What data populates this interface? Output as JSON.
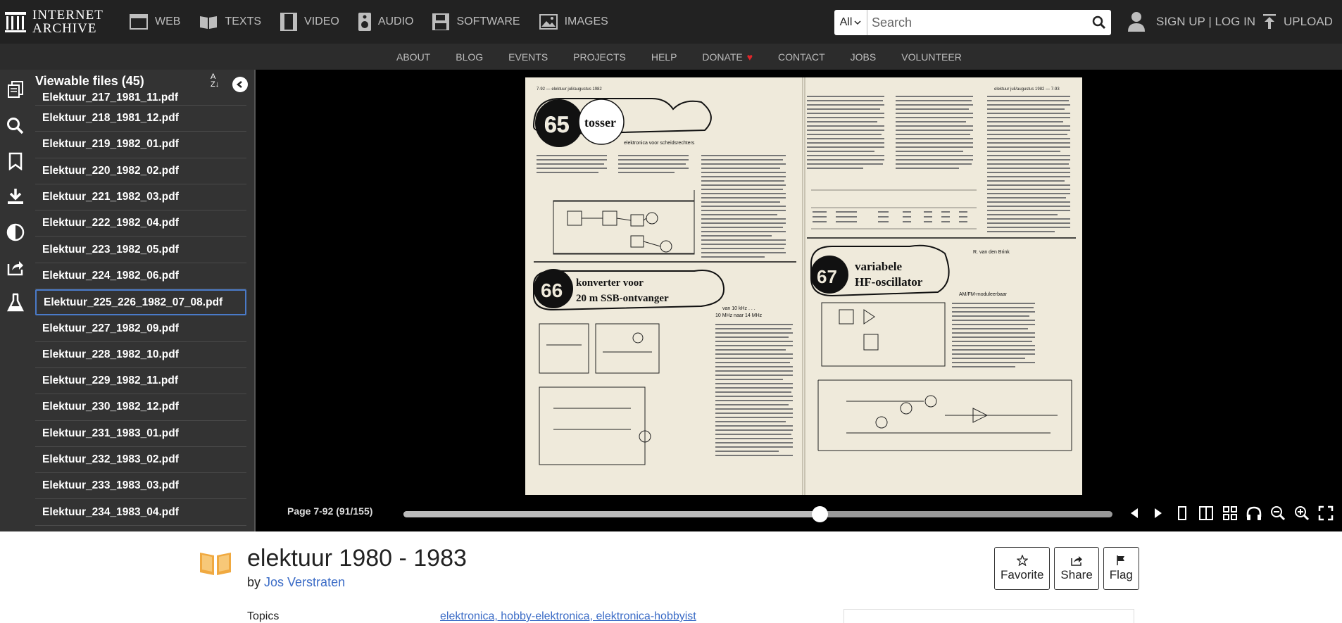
{
  "header": {
    "logo_line1": "INTERNET",
    "logo_line2": "ARCHIVE",
    "media_nav": [
      {
        "label": "WEB",
        "icon": "web-icon"
      },
      {
        "label": "TEXTS",
        "icon": "book-icon"
      },
      {
        "label": "VIDEO",
        "icon": "film-icon"
      },
      {
        "label": "AUDIO",
        "icon": "speaker-icon"
      },
      {
        "label": "SOFTWARE",
        "icon": "floppy-icon"
      },
      {
        "label": "IMAGES",
        "icon": "image-icon"
      }
    ],
    "search": {
      "scope": "All",
      "placeholder": "Search"
    },
    "auth_label": "SIGN UP | LOG IN",
    "upload_label": "UPLOAD"
  },
  "subnav": {
    "items": [
      "ABOUT",
      "BLOG",
      "EVENTS",
      "PROJECTS",
      "HELP",
      "DONATE",
      "CONTACT",
      "JOBS",
      "VOLUNTEER"
    ]
  },
  "files_panel": {
    "heading": "Viewable files (45)",
    "sort_label": "A Z",
    "files": [
      "Elektuur_217_1981_11.pdf",
      "Elektuur_218_1981_12.pdf",
      "Elektuur_219_1982_01.pdf",
      "Elektuur_220_1982_02.pdf",
      "Elektuur_221_1982_03.pdf",
      "Elektuur_222_1982_04.pdf",
      "Elektuur_223_1982_05.pdf",
      "Elektuur_224_1982_06.pdf",
      "Elektuur_225_226_1982_07_08.pdf",
      "Elektuur_227_1982_09.pdf",
      "Elektuur_228_1982_10.pdf",
      "Elektuur_229_1982_11.pdf",
      "Elektuur_230_1982_12.pdf",
      "Elektuur_231_1983_01.pdf",
      "Elektuur_232_1983_02.pdf",
      "Elektuur_233_1983_03.pdf",
      "Elektuur_234_1983_04.pdf"
    ],
    "active_file": "Elektuur_225_226_1982_07_08.pdf"
  },
  "page_content": {
    "left_header": "7-92 — elektuur juli/augustus 1982",
    "right_header": "elektuur juli/augustus 1982 — 7-93",
    "articles": [
      {
        "number": "65",
        "title": "tosser",
        "subtitle": "elektronica voor scheidsrechters"
      },
      {
        "number": "66",
        "title_line1": "konverter voor",
        "title_line2": "20 m SSB-ontvanger",
        "subtitle_line1": "van 10 kHz . . .",
        "subtitle_line2": "10 MHz naar 14 MHz"
      },
      {
        "number": "67",
        "title_line1": "variabele",
        "title_line2": "HF-oscillator",
        "author": "R. van den Brink",
        "subtitle": "AM/FM-moduleerbaar"
      }
    ]
  },
  "controls": {
    "page_label": "Page 7-92 (91/155)",
    "progress": 0.587
  },
  "item": {
    "title": "elektuur 1980 - 1983",
    "by_prefix": "by",
    "author": "Jos Verstraten",
    "topics_label": "Topics",
    "topics_value": "elektronica, hobby-elektronica, elektronica-hobbyist",
    "actions": [
      {
        "label": "Favorite",
        "icon": "star-icon"
      },
      {
        "label": "Share",
        "icon": "share-icon"
      },
      {
        "label": "Flag",
        "icon": "flag-icon"
      }
    ]
  },
  "colors": {
    "header_bg": "#222222",
    "subnav_bg": "#2c2c2c",
    "panel_bg": "#333333",
    "link": "#3a6bc6",
    "heart": "#e0262a",
    "active_border": "#4a7ac8"
  }
}
